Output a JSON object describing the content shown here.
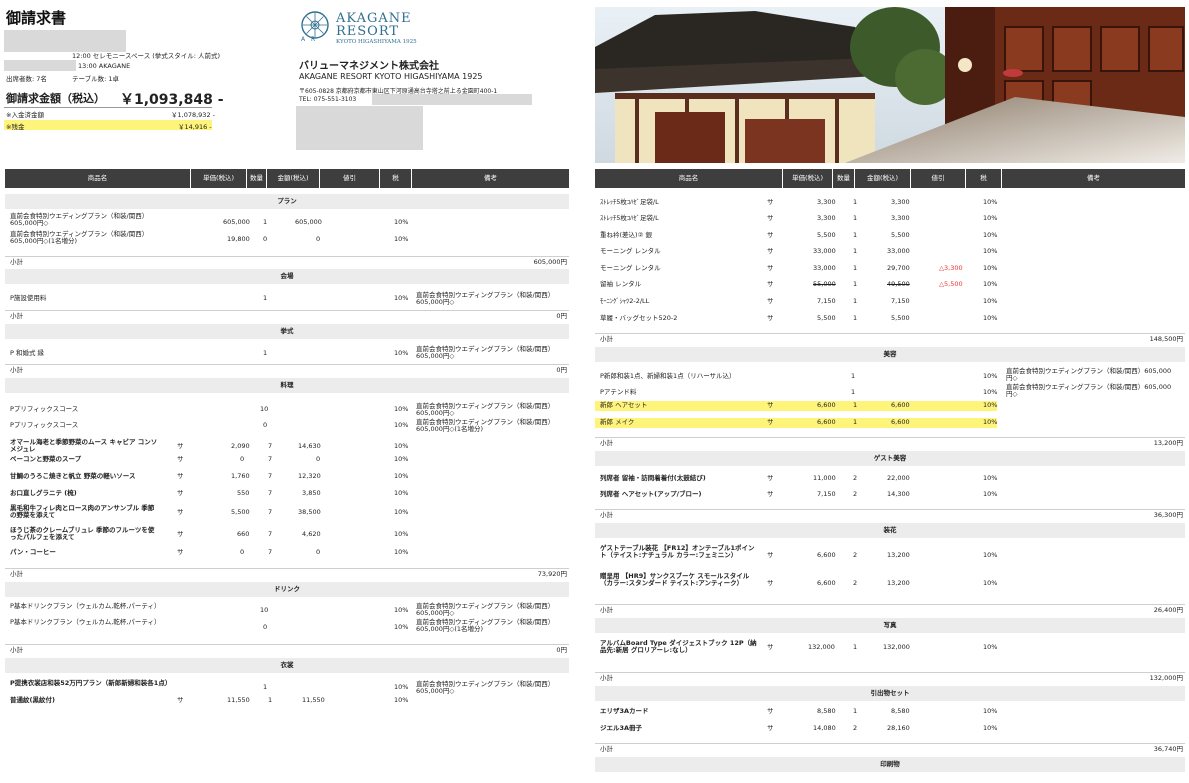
{
  "doc": {
    "title": "御請求書",
    "ceremony_line": "12:00 セレモニースペース (挙式スタイル: 人前式)",
    "reception_line": "13:00 AKAGANE",
    "guests": "出席者数: 7名",
    "tables": "テーブル数: 1卓",
    "total_label": "御請求金額（税込）",
    "total_amount": "￥1,093,848 -",
    "paid_label": "※入金済金額",
    "paid_amount": "￥1,078,932 -",
    "balance_label": "※残金",
    "balance_amount": "￥14,916 -"
  },
  "company": {
    "logo_line1": "AKAGANE",
    "logo_line2": "RESORT",
    "logo_line3": "KYOTO HIGASHIYAMA 1925",
    "logo_mark": "A R",
    "name": "バリューマネジメント株式会社",
    "name_en": "AKAGANE RESORT KYOTO HIGASHIYAMA 1925",
    "address": "〒605-0828 京都府京都市東山区下河原通高台寺塔之前上る金園町400-1",
    "tel": "TEL: 075-551-3103"
  },
  "headers": {
    "item": "商品名",
    "unit_price": "単価(税込)",
    "qty": "数量",
    "amount": "金額(税込)",
    "discount": "値引",
    "tax": "税",
    "note": "備考"
  },
  "left": {
    "plan": {
      "title": "プラン",
      "rows": [
        {
          "name": "直前会食特別ウエディングプラン（和装/関西）605,000円◇",
          "price": "605,000",
          "qty": "1",
          "amount": "605,000",
          "tax": "10%"
        },
        {
          "name": "直前会食特別ウエディングプラン（和装/関西）605,000円◇(1名増分)",
          "price": "19,800",
          "qty": "0",
          "amount": "0",
          "tax": "10%"
        }
      ],
      "subtotal_label": "小計",
      "subtotal": "605,000円"
    },
    "venue": {
      "title": "会場",
      "rows": [
        {
          "name": "P施設使用料",
          "qty": "1",
          "tax": "10%",
          "note": "直前会食特別ウエディングプラン（和装/関西）605,000円◇"
        }
      ],
      "subtotal_label": "小計",
      "subtotal": "0円"
    },
    "ceremony": {
      "title": "挙式",
      "rows": [
        {
          "name": "P 和婚式 縁",
          "qty": "1",
          "tax": "10%",
          "note": "直前会食特別ウエディングプラン（和装/関西）605,000円◇"
        }
      ],
      "subtotal_label": "小計",
      "subtotal": "0円"
    },
    "cuisine": {
      "title": "料理",
      "rows": [
        {
          "name": "Pプリフィックスコース",
          "qty": "10",
          "tax": "10%",
          "note": "直前会食特別ウエディングプラン（和装/関西）605,000円◇"
        },
        {
          "name": "Pプリフィックスコース",
          "qty": "0",
          "tax": "10%",
          "note": "直前会食特別ウエディングプラン（和装/関西）605,000円◇(1名増分)"
        },
        {
          "name": "オマール海老と季節野菜のムース キャビア コンソメジュレ",
          "mark": "サ",
          "price": "2,090",
          "qty": "7",
          "amount": "14,630",
          "tax": "10%"
        },
        {
          "name": "ベーコンと野菜のスープ",
          "mark": "サ",
          "price": "0",
          "qty": "7",
          "amount": "0",
          "tax": "10%"
        },
        {
          "name": "甘鯛のうろこ焼きと帆立 野菜の軽いソース",
          "mark": "サ",
          "price": "1,760",
          "qty": "7",
          "amount": "12,320",
          "tax": "10%"
        },
        {
          "name": "お口直しグラニテ (梳)",
          "mark": "サ",
          "price": "550",
          "qty": "7",
          "amount": "3,850",
          "tax": "10%"
        },
        {
          "name": "黒毛和牛フィレ肉とロース肉のアンサンブル 季節の野菜を添えて",
          "mark": "サ",
          "price": "5,500",
          "qty": "7",
          "amount": "38,500",
          "tax": "10%"
        },
        {
          "name": "ほうじ茶のクレームブリュレ 季節のフルーツを使ったパルフェを添えて",
          "mark": "サ",
          "price": "660",
          "qty": "7",
          "amount": "4,620",
          "tax": "10%"
        },
        {
          "name": "パン・コーヒー",
          "mark": "サ",
          "price": "0",
          "qty": "7",
          "amount": "0",
          "tax": "10%"
        }
      ],
      "subtotal_label": "小計",
      "subtotal": "73,920円"
    },
    "drink": {
      "title": "ドリンク",
      "rows": [
        {
          "name": "P基本ドリンクプラン（ウェルカム,乾杯,パーティ）",
          "qty": "10",
          "tax": "10%",
          "note": "直前会食特別ウエディングプラン（和装/関西）605,000円◇"
        },
        {
          "name": "P基本ドリンクプラン（ウェルカム,乾杯,パーティ）",
          "qty": "0",
          "tax": "10%",
          "note": "直前会食特別ウエディングプラン（和装/関西）605,000円◇(1名増分)"
        }
      ],
      "subtotal_label": "小計",
      "subtotal": "0円"
    },
    "costume": {
      "title": "衣裳",
      "rows": [
        {
          "name": "P提携衣裳店和装52万円プラン（新郎新婦和装各1点）",
          "qty": "1",
          "tax": "10%",
          "note": "直前会食特別ウエディングプラン（和装/関西）605,000円◇"
        },
        {
          "name": "普通紋(黒紋付)",
          "mark": "サ",
          "price": "11,550",
          "qty": "1",
          "amount": "11,550",
          "tax": "10%"
        }
      ]
    }
  },
  "right": {
    "costume_rows": [
      {
        "name": "ｽﾄﾚｯﾁ5枚ｺﾊｾﾞ足袋/L",
        "mark": "サ",
        "price": "3,300",
        "qty": "1",
        "amount": "3,300",
        "tax": "10%"
      },
      {
        "name": "ｽﾄﾚｯﾁ5枚ｺﾊｾﾞ足袋/L",
        "mark": "サ",
        "price": "3,300",
        "qty": "1",
        "amount": "3,300",
        "tax": "10%"
      },
      {
        "name": "重ね衿(差込)② 銀",
        "mark": "サ",
        "price": "5,500",
        "qty": "1",
        "amount": "5,500",
        "tax": "10%"
      },
      {
        "name": "モーニング レンタル",
        "mark": "サ",
        "price": "33,000",
        "qty": "1",
        "amount": "33,000",
        "tax": "10%"
      },
      {
        "name": "モーニング レンタル",
        "mark": "サ",
        "price": "33,000",
        "qty": "1",
        "amount": "29,700",
        "discount": "△3,300",
        "tax": "10%"
      },
      {
        "name": "留袖 レンタル",
        "mark": "サ",
        "price": "55,000",
        "qty": "1",
        "amount": "49,500",
        "discount": "△5,500",
        "tax": "10%",
        "strike": true
      },
      {
        "name": "ﾓｰﾆﾝｸﾞｼｬﾂ2-2/LL",
        "mark": "サ",
        "price": "7,150",
        "qty": "1",
        "amount": "7,150",
        "tax": "10%"
      },
      {
        "name": "草履・バッグセット520-2",
        "mark": "サ",
        "price": "5,500",
        "qty": "1",
        "amount": "5,500",
        "tax": "10%"
      }
    ],
    "costume_subtotal_label": "小計",
    "costume_subtotal": "148,500円",
    "beauty": {
      "title": "美容",
      "rows": [
        {
          "name": "P新郎和装1点、新婦和装1点（リハーサル込）",
          "qty": "1",
          "tax": "10%",
          "note": "直前会食特別ウエディングプラン（和装/関西）605,000円◇"
        },
        {
          "name": "Pアテンド料",
          "qty": "1",
          "tax": "10%",
          "note": "直前会食特別ウエディングプラン（和装/関西）605,000円◇"
        },
        {
          "name": "新郎 ヘアセット",
          "mark": "サ",
          "price": "6,600",
          "qty": "1",
          "amount": "6,600",
          "tax": "10%",
          "hl": true
        },
        {
          "name": "新郎 メイク",
          "mark": "サ",
          "price": "6,600",
          "qty": "1",
          "amount": "6,600",
          "tax": "10%",
          "hl": true
        }
      ],
      "subtotal_label": "小計",
      "subtotal": "13,200円"
    },
    "guest_beauty": {
      "title": "ゲスト美容",
      "rows": [
        {
          "name": "列席者 留袖・訪問着着付(太鼓結び)",
          "mark": "サ",
          "price": "11,000",
          "qty": "2",
          "amount": "22,000",
          "tax": "10%"
        },
        {
          "name": "列席者 ヘアセット(アップ/ブロー)",
          "mark": "サ",
          "price": "7,150",
          "qty": "2",
          "amount": "14,300",
          "tax": "10%"
        }
      ],
      "subtotal_label": "小計",
      "subtotal": "36,300円"
    },
    "flowers": {
      "title": "装花",
      "rows": [
        {
          "name": "ゲストテーブル装花 【FR12】オンテーブル1ポイント（テイスト:ナチュラル カラー:フェミニン）",
          "mark": "サ",
          "price": "6,600",
          "qty": "2",
          "amount": "13,200",
          "tax": "10%"
        },
        {
          "name": "贈呈用 【HR9】サンクスブーケ スモールスタイル（カラー:スタンダード テイスト:アンティーク）",
          "mark": "サ",
          "price": "6,600",
          "qty": "2",
          "amount": "13,200",
          "tax": "10%"
        }
      ],
      "subtotal_label": "小計",
      "subtotal": "26,400円"
    },
    "photo": {
      "title": "写真",
      "rows": [
        {
          "name": "アルバムBoard Type ダイジェストブック 12P（納品先:新居 グロリアーレ:なし）",
          "mark": "サ",
          "price": "132,000",
          "qty": "1",
          "amount": "132,000",
          "tax": "10%"
        }
      ],
      "subtotal_label": "小計",
      "subtotal": "132,000円"
    },
    "gifts": {
      "title": "引出物セット",
      "rows": [
        {
          "name": "エリザ3Aカード",
          "mark": "サ",
          "price": "8,580",
          "qty": "1",
          "amount": "8,580",
          "tax": "10%"
        },
        {
          "name": "ジエル3A冊子",
          "mark": "サ",
          "price": "14,080",
          "qty": "2",
          "amount": "28,160",
          "tax": "10%"
        }
      ],
      "subtotal_label": "小計",
      "subtotal": "36,740円"
    },
    "print_title": "印刷物"
  }
}
